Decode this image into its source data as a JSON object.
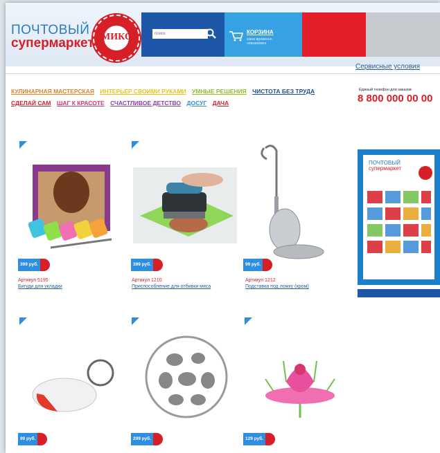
{
  "header": {
    "logo_line1": "ПОЧТОВЫЙ",
    "logo_line2": "супермаркет",
    "seal_word": "МИКС",
    "search_placeholder": "поиск",
    "cart_title": "КОРЗИНА",
    "cart_note": "заказ временно невозможен",
    "service_link": "Сервисные условия"
  },
  "nav": [
    {
      "label": "КУЛИНАРНАЯ МАСТЕРСКАЯ",
      "color": "#e8821e"
    },
    {
      "label": "ИНТЕРЬЕР СВОИМИ РУКАМИ",
      "color": "#e8c41e"
    },
    {
      "label": "УМНЫЕ РЕШЕНИЯ",
      "color": "#8fbf2a"
    },
    {
      "label": "ЧИСТОТА БЕЗ ТРУДА",
      "color": "#1f4f8f"
    },
    {
      "label": "СДЕЛАЙ САМ",
      "color": "#d61f26"
    },
    {
      "label": "ШАГ К КРАСОТЕ",
      "color": "#d8366e"
    },
    {
      "label": "СЧАСТЛИВОЕ ДЕТСТВО",
      "color": "#8c3fa8"
    },
    {
      "label": "ДОСУГ",
      "color": "#2f8ee0"
    },
    {
      "label": "ДАЧА",
      "color": "#d61f26"
    }
  ],
  "phone": {
    "caption": "Единый телефон для заказов",
    "number": "8 800 000 00 00"
  },
  "products": [
    {
      "price": "399 руб.",
      "article": "Артикул 5195",
      "name": "Бигуди для укладки",
      "icon": "hair-curlers"
    },
    {
      "price": "399 руб.",
      "article": "Артикул 1210",
      "name": "Приспособление для отбивки мяса",
      "icon": "meat-tenderizer"
    },
    {
      "price": "99 руб.",
      "article": "Артикул 1212",
      "name": "Подставка под ложку (хром)",
      "icon": "spoon-rest"
    },
    {
      "price": "99 руб.",
      "article": "",
      "name": "",
      "icon": "keychain"
    },
    {
      "price": "299 руб.",
      "article": "",
      "name": "",
      "icon": "laundry-ball"
    },
    {
      "price": "129 руб.",
      "article": "",
      "name": "",
      "icon": "lotus-candle"
    }
  ],
  "catalog": {
    "title_line1": "ПОЧТОВЫЙ",
    "title_line2": "супермаркет"
  },
  "colors": {
    "brand_blue": "#1e56a8",
    "accent_blue": "#2f8ee0",
    "brand_red": "#d61f26"
  }
}
